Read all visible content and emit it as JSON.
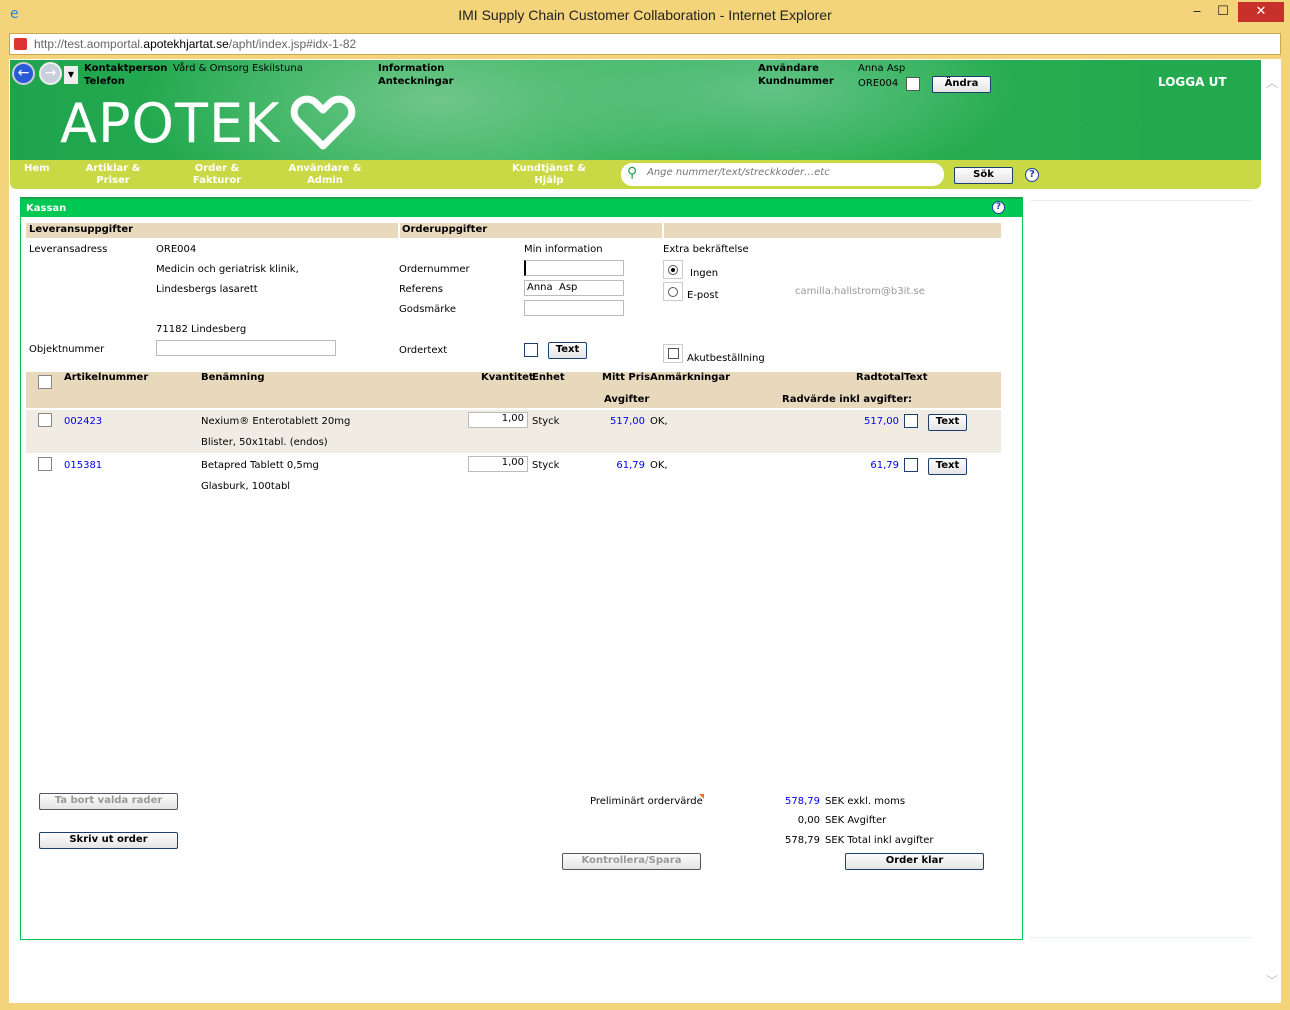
{
  "window": {
    "title": "IMI Supply Chain Customer Collaboration - Internet Explorer",
    "address_prefix": "http://test.aomportal.",
    "address_domain": "apotekhjartat.se",
    "address_path": "/apht/index.jsp#idx-1-82",
    "minimize": "‒",
    "maximize": "☐",
    "close": "✕"
  },
  "header": {
    "contact_label": "Kontaktperson",
    "contact_value": "Vård & Omsorg Eskilstuna",
    "phone_label": "Telefon",
    "info_label": "Information",
    "notes_label": "Anteckningar",
    "user_label": "Användare",
    "user_value": "Anna Asp",
    "customer_label": "Kundnummer",
    "customer_value": "ORE004",
    "change_button": "Ändra",
    "logout": "LOGGA UT",
    "logo": "APOTEK"
  },
  "nav": {
    "items": [
      {
        "label": "Hem"
      },
      {
        "label": "Artiklar & Priser"
      },
      {
        "label": "Order & Fakturor"
      },
      {
        "label": "Användare & Admin"
      },
      {
        "label": "Kundtjänst & Hjälp"
      }
    ],
    "search_placeholder": "Ange nummer/text/streckkoder…etc",
    "search_button": "Sök",
    "help": "?"
  },
  "panel": {
    "title": "Kassan",
    "help": "?",
    "delivery_header": "Leveransuppgifter",
    "order_header": "Orderuppgifter",
    "address_label": "Leveransadress",
    "address_lines": [
      "ORE004",
      "Medicin och geriatrisk klinik,",
      "Lindesbergs lasarett",
      "71182 Lindesberg"
    ],
    "object_label": "Objektnummer",
    "object_value": "",
    "my_info": "Min information",
    "order_no_label": "Ordernummer",
    "order_no_value": "",
    "reference_label": "Referens",
    "reference_value": "Anna  Asp",
    "goods_label": "Godsmärke",
    "goods_value": "",
    "ordertext_label": "Ordertext",
    "text_button": "Text",
    "extra_confirm": "Extra bekräftelse",
    "radio_none": "Ingen",
    "radio_email": "E-post",
    "email": "camilla.hallstrom@b3it.se",
    "urgent": "Akutbeställning",
    "selected_confirm": "Ingen"
  },
  "table": {
    "headers": {
      "article": "Artikelnummer",
      "name": "Benämning",
      "qty": "Kvantitet",
      "unit": "Enhet",
      "price": "Mitt Pris",
      "remarks": "Anmärkningar",
      "total": "Radtotal",
      "text": "Text",
      "fees": "Avgifter",
      "row_value": "Radvärde inkl avgifter:"
    },
    "rows": [
      {
        "article": "002423",
        "name": "Nexium® Enterotablett 20mg",
        "desc": "Blister, 50x1tabl. (endos)",
        "qty": "1,00",
        "unit": "Styck",
        "price": "517,00",
        "remarks": "OK,",
        "total": "517,00",
        "text_button": "Text"
      },
      {
        "article": "015381",
        "name": "Betapred Tablett 0,5mg",
        "desc": "Glasburk, 100tabl",
        "qty": "1,00",
        "unit": "Styck",
        "price": "61,79",
        "remarks": "OK,",
        "total": "61,79",
        "text_button": "Text"
      }
    ]
  },
  "footer": {
    "remove_button": "Ta bort valda rader",
    "print_button": "Skriv ut order",
    "prelim_label": "Preliminärt ordervärde",
    "excl_value": "578,79",
    "excl_label": "SEK exkl. moms",
    "fees_value": "0,00",
    "fees_label": "SEK Avgifter",
    "total_value": "578,79",
    "total_label": "SEK Total inkl avgifter",
    "check_button": "Kontrollera/Spara",
    "done_button": "Order klar"
  },
  "colors": {
    "brand_green": "#00c853",
    "nav_lime": "#c9d945",
    "link_blue": "#0000ee",
    "window_frame": "#f3d47a"
  }
}
